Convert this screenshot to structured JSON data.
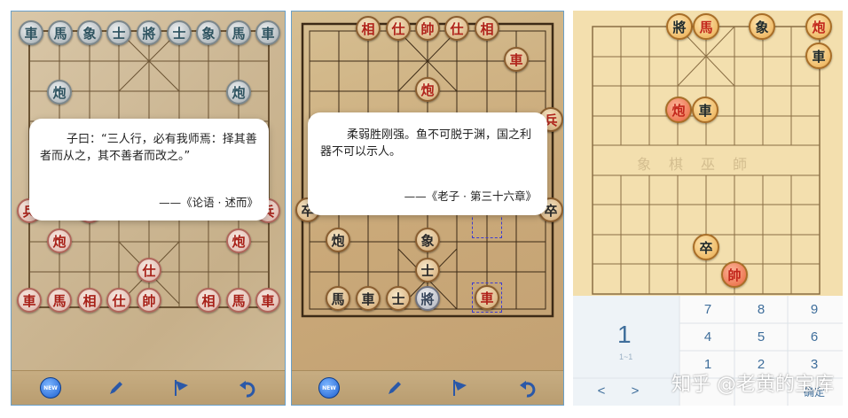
{
  "panel1": {
    "top_row": [
      "車",
      "馬",
      "象",
      "士",
      "將",
      "士",
      "象",
      "馬",
      "車"
    ],
    "black_cannons": [
      "炮",
      "炮"
    ],
    "black_pawns_partial": [
      "兵",
      "兵",
      "兵"
    ],
    "red_cannons": [
      "炮",
      "炮"
    ],
    "red_advisor_mid": "仕",
    "bottom_row": [
      "車",
      "馬",
      "相",
      "仕",
      "帥",
      "相",
      "馬",
      "車"
    ],
    "quote": {
      "text": "子曰：“三人行，必有我师焉：择其善者而从之，其不善者而改之。”",
      "source": "——《论语 · 述而》"
    }
  },
  "panel2": {
    "top_row": [
      "相",
      "仕",
      "帥",
      "仕",
      "相"
    ],
    "red_chariot": "車",
    "red_cannon": "炮",
    "side_pieces": [
      "兵",
      "卒",
      "卒"
    ],
    "black_cannon": "炮",
    "black_elephant": "象",
    "black_advisor": "士",
    "bottom_row": [
      "馬",
      "車",
      "士",
      "將"
    ],
    "red_chariot_bottom": "車",
    "quote": {
      "text": "柔弱胜刚强。鱼不可脱于渊，国之利器不可以示人。",
      "source": "——《老子 · 第三十六章》"
    }
  },
  "panel3": {
    "top_pieces": [
      "將",
      "馬",
      "象",
      "炮",
      "車"
    ],
    "mid_pieces": [
      "炮",
      "車"
    ],
    "river_text": [
      "象",
      "棋",
      "巫",
      "師"
    ],
    "lower_pieces": [
      "卒",
      "帥"
    ],
    "keypad": {
      "display": "1",
      "display_sub": "1~1",
      "left_arrow": "<",
      "right_arrow": ">",
      "keys": [
        "7",
        "8",
        "9",
        "4",
        "5",
        "6",
        "1",
        "2",
        "3"
      ],
      "confirm": "确定"
    },
    "watermark": "知乎 @老黄的宝库"
  },
  "toolbar": {
    "new_badge": "NEW"
  }
}
